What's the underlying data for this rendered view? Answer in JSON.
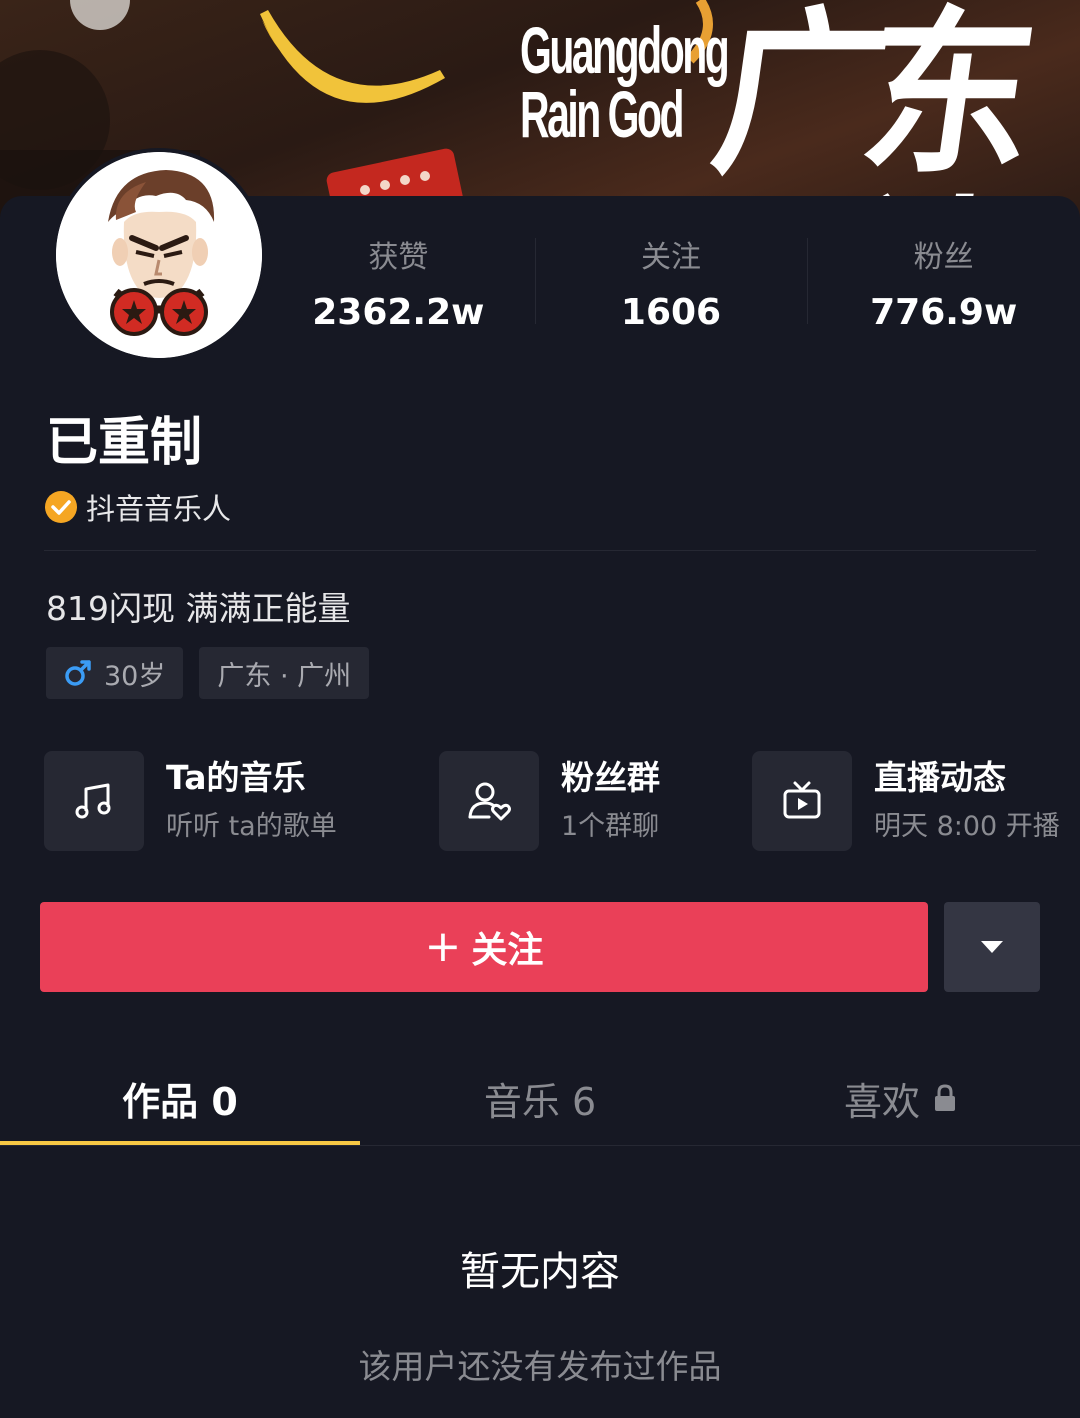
{
  "banner": {
    "title_en_line1": "Guangdong",
    "title_en_line2": "Rain God",
    "title_cn": "广东雨神"
  },
  "profile": {
    "name": "已重制",
    "verification": "抖音音乐人",
    "bio": "819闪现 满满正能量",
    "tags": {
      "age": "30岁",
      "location": "广东 · 广州"
    }
  },
  "stats": [
    {
      "label": "获赞",
      "value": "2362.2w"
    },
    {
      "label": "关注",
      "value": "1606"
    },
    {
      "label": "粉丝",
      "value": "776.9w"
    }
  ],
  "features": [
    {
      "title": "Ta的音乐",
      "subtitle": "听听 ta的歌单",
      "icon": "music-note-icon"
    },
    {
      "title": "粉丝群",
      "subtitle": "1个群聊",
      "icon": "fan-group-icon"
    },
    {
      "title": "直播动态",
      "subtitle": "明天 8:00 开播",
      "icon": "tv-live-icon"
    }
  ],
  "actions": {
    "follow_label": "关注"
  },
  "tabs": [
    {
      "label": "作品 0"
    },
    {
      "label": "音乐 6"
    },
    {
      "label": "喜欢"
    }
  ],
  "empty": {
    "title": "暂无内容",
    "subtitle": "该用户还没有发布过作品"
  },
  "colors": {
    "background": "#161823",
    "card": "#262833",
    "follow_button": "#ea4058",
    "tab_indicator": "#f7c844",
    "verify_badge": "#f5a623"
  }
}
